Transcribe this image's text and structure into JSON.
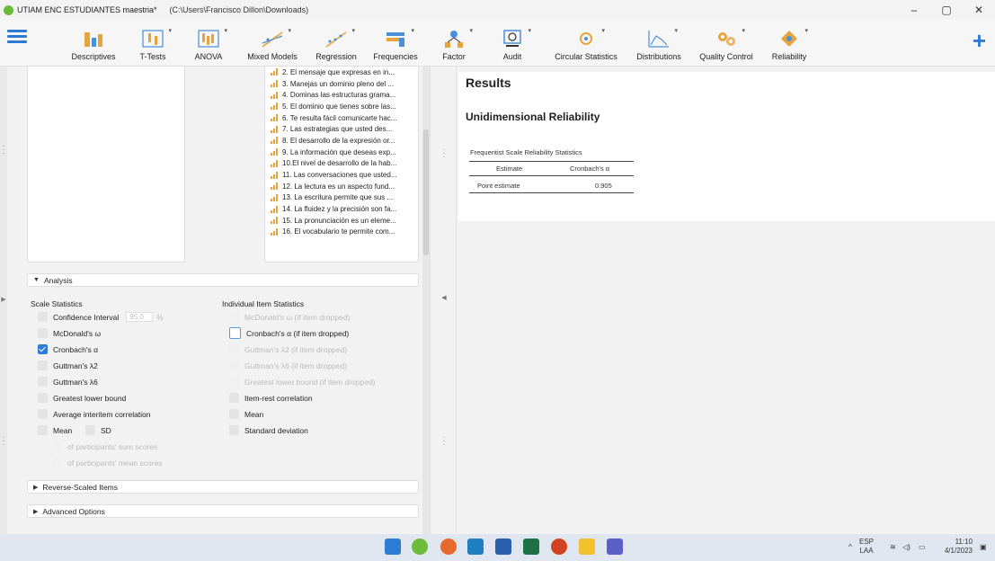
{
  "window": {
    "title": "UTIAM ENC ESTUDIANTES maestria*",
    "path": "(C:\\Users\\Francisco Dillon\\Downloads)",
    "minimize": "–",
    "maximize": "▢",
    "close": "✕"
  },
  "ribbon": {
    "items": [
      {
        "label": "Descriptives",
        "icon": "descriptives-icon"
      },
      {
        "label": "T-Tests",
        "icon": "ttests-icon"
      },
      {
        "label": "ANOVA",
        "icon": "anova-icon"
      },
      {
        "label": "Mixed Models",
        "icon": "mixed-models-icon"
      },
      {
        "label": "Regression",
        "icon": "regression-icon"
      },
      {
        "label": "Frequencies",
        "icon": "frequencies-icon"
      },
      {
        "label": "Factor",
        "icon": "factor-icon"
      },
      {
        "label": "Audit",
        "icon": "audit-icon"
      },
      {
        "label": "Circular Statistics",
        "icon": "circular-icon"
      },
      {
        "label": "Distributions",
        "icon": "distributions-icon"
      },
      {
        "label": "Quality Control",
        "icon": "quality-control-icon"
      },
      {
        "label": "Reliability",
        "icon": "reliability-icon"
      }
    ],
    "add": "+"
  },
  "variables": [
    "2. El mensaje que expresas en in...",
    "3. Manejas un dominio pleno del ...",
    "4. Dominas las estructuras grama...",
    "5. El dominio que tienes sobre las...",
    "6. Te resulta fácil comunicarte hac...",
    "7. Las estrategias  que  usted des...",
    "8. El desarrollo de la expresión or...",
    "9. La información que deseas exp...",
    "10.El nivel de desarrollo de la hab...",
    "11. Las conversaciones que usted...",
    "12. La lectura es un aspecto fund...",
    "13.  La escritura permite que sus ...",
    "14. La fluidez y la precisión son fa...",
    "15. La pronunciación es un eleme...",
    "16. El vocabulario te permite com..."
  ],
  "analysis": {
    "section_label": "Analysis",
    "scale_header": "Scale Statistics",
    "item_header": "Individual Item Statistics",
    "ci_label": "Confidence Interval",
    "ci_value": "95.0",
    "ci_unit": "%",
    "scale_opts": [
      "McDonald's ω",
      "Cronbach's α",
      "Guttman's λ2",
      "Guttman's λ6",
      "Greatest lower bound",
      "Average interitem correlation"
    ],
    "mean": "Mean",
    "sd": "SD",
    "sum_scores": "of participants' sum scores",
    "mean_scores": "of participants' mean scores",
    "item_opts": [
      "McDonald's ω  (if item dropped)",
      "Cronbach's α (if item dropped)",
      "Guttman's λ2 (if item dropped)",
      "Guttman's λ6 (if item dropped)",
      "Greatest lower bound (if item dropped)",
      "Item-rest correlation",
      "Mean",
      "Standard deviation"
    ],
    "reverse": "Reverse-Scaled Items",
    "advanced": "Advanced Options"
  },
  "results": {
    "title": "Results",
    "subtitle": "Unidimensional Reliability",
    "table_caption": "Frequentist Scale Reliability Statistics",
    "col1": "Estimate",
    "col2": "Cronbach's α",
    "row_label": "Point estimate",
    "row_value": "0.905"
  },
  "tray": {
    "lang1": "ESP",
    "lang2": "LAA",
    "time": "11:10",
    "date": "4/1/2023"
  }
}
